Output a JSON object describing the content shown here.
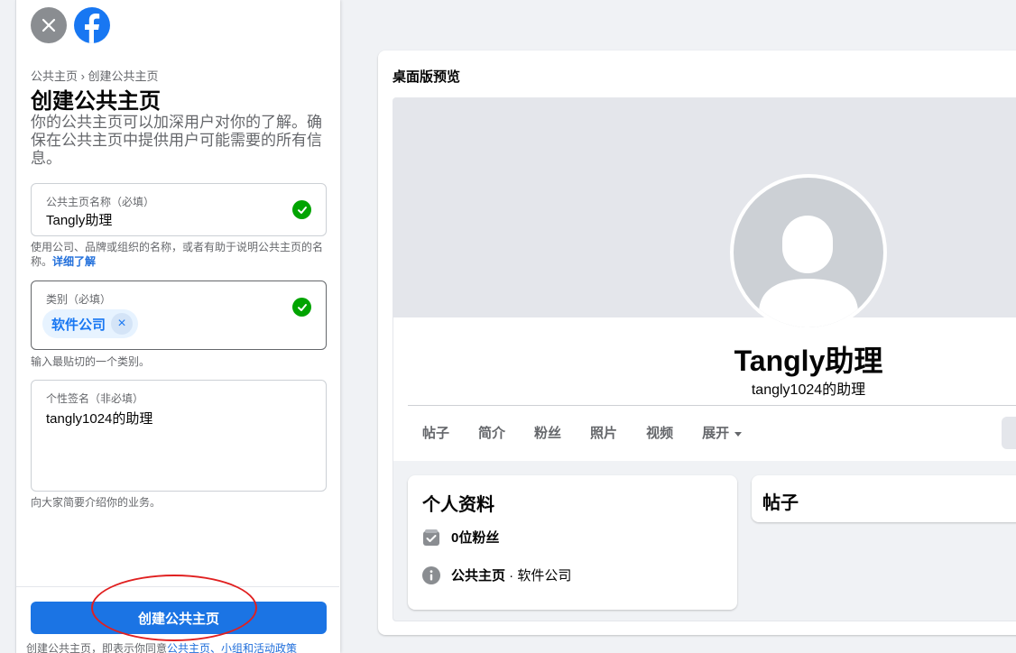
{
  "left": {
    "breadcrumb": "公共主页 › 创建公共主页",
    "title": "创建公共主页",
    "description": "你的公共主页可以加深用户对你的了解。确保在公共主页中提供用户可能需要的所有信息。",
    "name_field": {
      "label": "公共主页名称（必填）",
      "value": "Tangly助理",
      "helper": "使用公司、品牌或组织的名称，或者有助于说明公共主页的名称。",
      "helper_link": "详细了解"
    },
    "category_field": {
      "label": "类别（必填）",
      "chip": "软件公司",
      "chip_remove": "×",
      "helper": "输入最贴切的一个类别。"
    },
    "bio_field": {
      "label": "个性签名（非必填）",
      "value": "tangly1024的助理",
      "helper": "向大家简要介绍你的业务。"
    },
    "create_button": "创建公共主页",
    "terms_prefix": "创建公共主页，即表示你同意",
    "terms_link": "公共主页、小组和活动政策"
  },
  "preview": {
    "title": "桌面版预览",
    "profile_name": "Tangly助理",
    "profile_sub": "tangly1024的助理",
    "tabs": [
      "帖子",
      "简介",
      "粉丝",
      "照片",
      "视频",
      "展开"
    ],
    "info_card": {
      "title": "个人资料",
      "followers": "0位粉丝",
      "type_strong": "公共主页",
      "type_rest": " · 软件公司"
    },
    "posts_card": {
      "title": "帖子"
    }
  },
  "colors": {
    "brand": "#1877f2",
    "check": "#00a400",
    "annotation": "#e02020"
  }
}
